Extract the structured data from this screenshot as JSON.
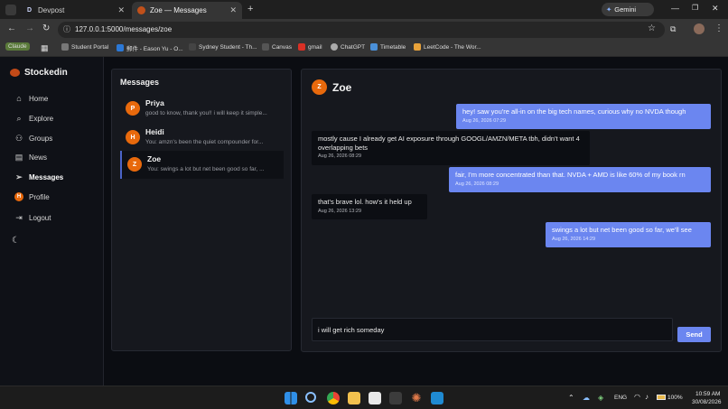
{
  "browser": {
    "tabs": [
      {
        "label": "Devpost",
        "favicon": "D",
        "active": false
      },
      {
        "label": "Zoe — Messages",
        "active": true
      }
    ],
    "gemini_label": "Gemini",
    "url": "127.0.0.1:5000/messages/zoe",
    "bookmarks": [
      "Claude",
      "Student Portal",
      "郵件 - Eason Yu - O...",
      "Sydney Student - Th...",
      "Canvas",
      "gmail",
      "ChatGPT",
      "Timetable",
      "LeetCode - The Wor..."
    ]
  },
  "app": {
    "brand": "Stockedin",
    "nav": [
      {
        "label": "Home",
        "icon": "home-icon"
      },
      {
        "label": "Explore",
        "icon": "search-icon"
      },
      {
        "label": "Groups",
        "icon": "users-icon"
      },
      {
        "label": "News",
        "icon": "newspaper-icon"
      },
      {
        "label": "Messages",
        "icon": "send-icon",
        "active": true
      },
      {
        "label": "Profile",
        "icon": "avatar-icon",
        "avatar_letter": "H"
      },
      {
        "label": "Logout",
        "icon": "logout-icon"
      }
    ],
    "messages_title": "Messages",
    "conversations": [
      {
        "name": "Priya",
        "initial": "P",
        "preview": "good to know, thank you!! i will keep it simple..."
      },
      {
        "name": "Heidi",
        "initial": "H",
        "preview": "You: amzn's been the quiet compounder for..."
      },
      {
        "name": "Zoe",
        "initial": "Z",
        "preview": "You: swings a lot but net been good so far, ...",
        "active": true
      }
    ],
    "chat": {
      "contact_name": "Zoe",
      "contact_initial": "Z",
      "messages": [
        {
          "from": "me",
          "text": "hey! saw you're all-in on the big tech names, curious why no NVDA though",
          "time": "Aug 26, 2026 07:29"
        },
        {
          "from": "them",
          "text": "mostly cause I already get AI exposure through GOOGL/AMZN/META tbh, didn't want 4 overlapping bets",
          "time": "Aug 26, 2026 08:29"
        },
        {
          "from": "me",
          "text": "fair, I'm more concentrated than that. NVDA + AMD is like 60% of my book rn",
          "time": "Aug 26, 2026 08:29"
        },
        {
          "from": "them",
          "text": "that's brave lol. how's it held up",
          "time": "Aug 26, 2026 13:29"
        },
        {
          "from": "me",
          "text": "swings a lot but net been good so far, we'll see",
          "time": "Aug 26, 2026 14:29"
        }
      ],
      "composer_value": "i will get rich someday",
      "send_label": "Send"
    }
  },
  "taskbar": {
    "language": "ENG",
    "battery": "100%",
    "time": "10:59 AM",
    "date": "30/08/2026"
  },
  "colors": {
    "accent": "#6b86f0",
    "avatar_orange": "#e8690c",
    "background": "#0b0d12",
    "panel": "#16181e"
  }
}
